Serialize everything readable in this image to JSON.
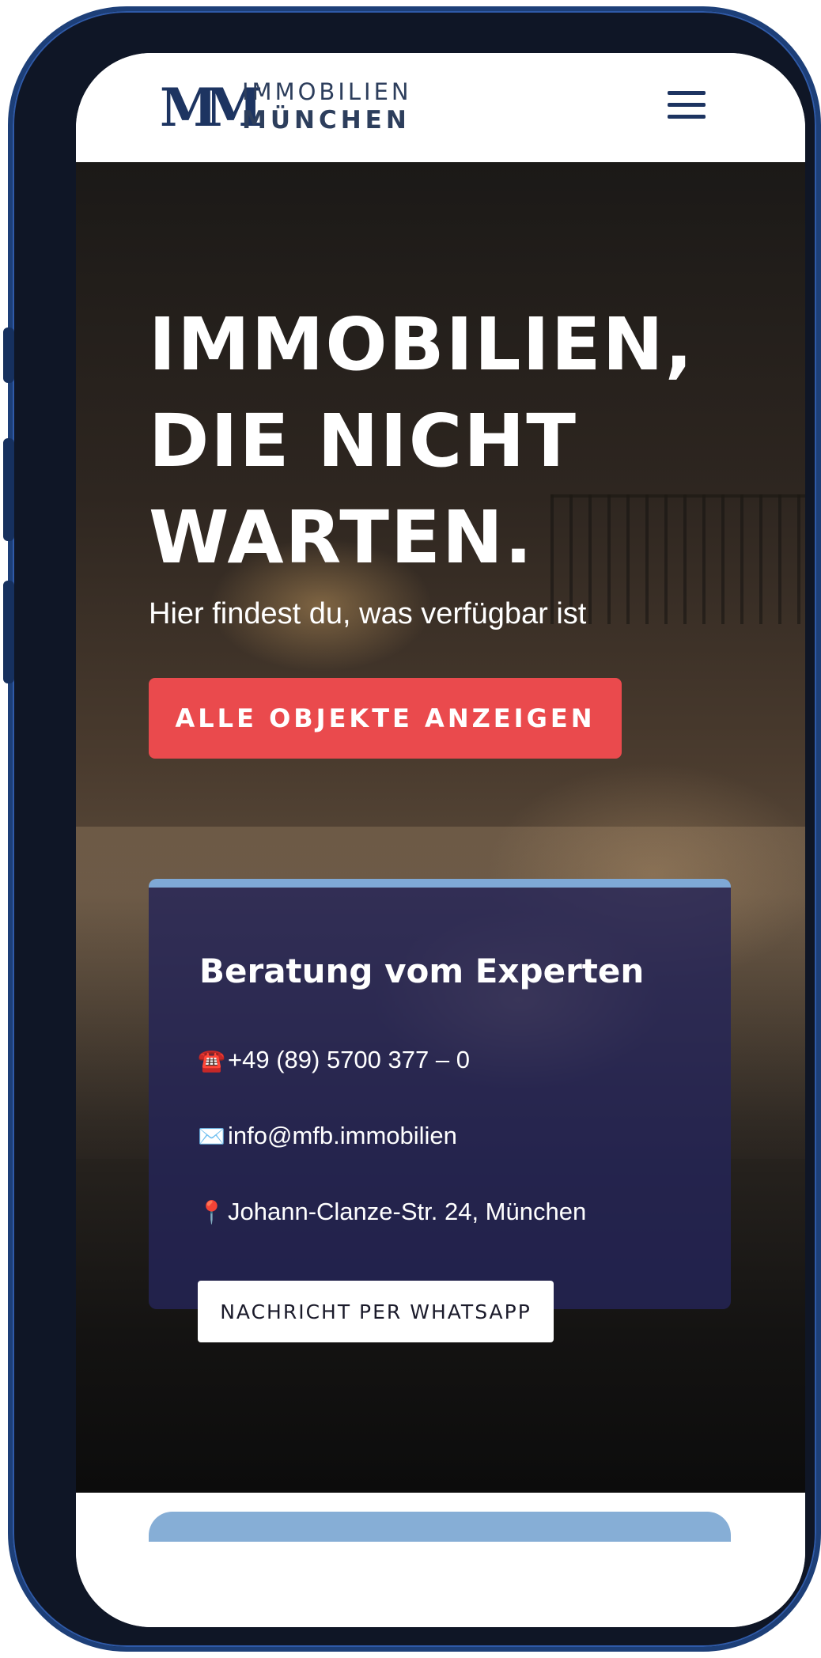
{
  "header": {
    "logo_mark": "M",
    "logo_line1": "IMMOBILIEN",
    "logo_line2": "MÜNCHEN",
    "menu_icon": "hamburger-menu-icon"
  },
  "hero": {
    "title_line1": "IMMOBILIEN,",
    "title_line2": "DIE NICHT",
    "title_line3": "WARTEN.",
    "subtitle": "Hier findest du, was verfügbar ist",
    "cta_label": "ALLE OBJEKTE ANZEIGEN"
  },
  "contact": {
    "title": "Beratung vom Experten",
    "phone_icon": "☎️",
    "phone": "+49 (89) 5700 377 – 0",
    "email_icon": "✉️",
    "email": "info@mfb.immobilien",
    "address_icon": "📍",
    "address": "Johann-Clanze-Str. 24, München",
    "whatsapp_label": "NACHRICHT PER WHATSAPP"
  },
  "colors": {
    "brand_navy": "#1d3461",
    "cta_red": "#ea4a4d",
    "card_bg": "#24245a",
    "card_accent": "#7fa9d6",
    "phone_frame": "#1d3f78"
  }
}
